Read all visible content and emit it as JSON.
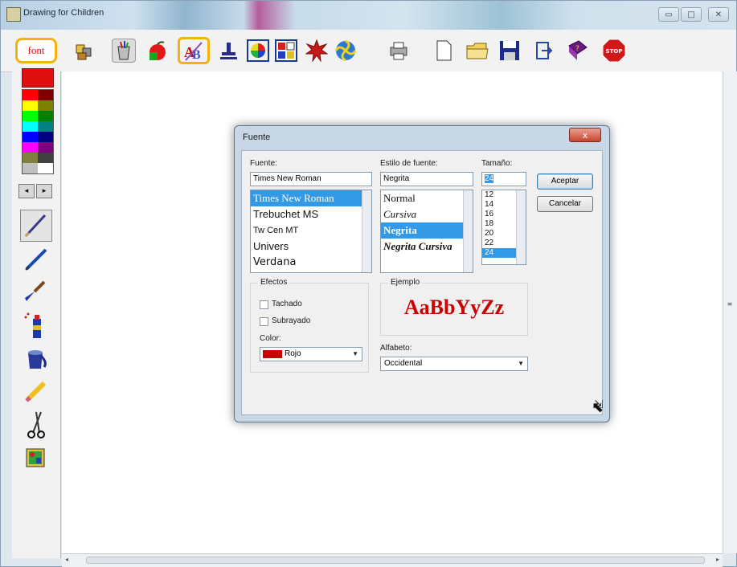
{
  "window": {
    "title": "Drawing for Children"
  },
  "toolbar": {
    "font_label": "font",
    "stop_label": "STOP",
    "tools": [
      "puzzle-icon",
      "paint-cup-icon",
      "apple-icon",
      "text-ab-icon",
      "stamp-icon",
      "palette-wheel-icon",
      "grid-icon",
      "burst-icon",
      "spiral-icon",
      "printer-icon",
      "new-page-icon",
      "open-folder-icon",
      "save-disk-icon",
      "exit-door-icon",
      "help-book-icon",
      "stop-sign-icon"
    ],
    "selected_tool": "text-ab-icon"
  },
  "palette": {
    "current": "#e01010",
    "colors": [
      "#ff0000",
      "#800000",
      "#ffff00",
      "#808000",
      "#00ff00",
      "#008000",
      "#00ffff",
      "#008080",
      "#0000ff",
      "#000080",
      "#ff00ff",
      "#800080",
      "#808040",
      "#404040",
      "#c0c0c0",
      "#ffffff"
    ]
  },
  "dialog": {
    "title": "Fuente",
    "close_label": "x",
    "font_label": "Fuente:",
    "font_value": "Times New Roman",
    "fonts": [
      "Times New Roman",
      "Trebuchet MS",
      "Tw Cen MT",
      "Univers",
      "Verdana"
    ],
    "style_label": "Estilo de fuente:",
    "style_value": "Negrita",
    "styles": [
      "Normal",
      "Cursiva",
      "Negrita",
      "Negrita Cursiva"
    ],
    "size_label": "Tamaño:",
    "size_value": "24",
    "sizes": [
      "12",
      "14",
      "16",
      "18",
      "20",
      "22",
      "24"
    ],
    "ok_label": "Aceptar",
    "cancel_label": "Cancelar",
    "effects_label": "Efectos",
    "strike_label": "Tachado",
    "underline_label": "Subrayado",
    "color_label": "Color:",
    "color_value": "Rojo",
    "color_hex": "#cc0000",
    "sample_label": "Ejemplo",
    "sample_text": "AaBbYyZz",
    "script_label": "Alfabeto:",
    "script_value": "Occidental"
  }
}
